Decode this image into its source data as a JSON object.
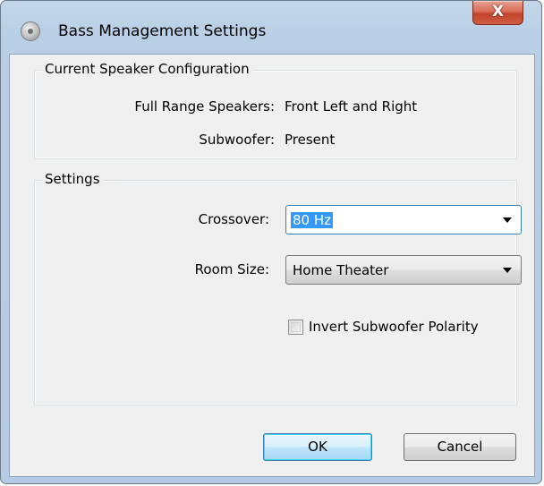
{
  "window": {
    "title": "Bass Management Settings",
    "close_label": "X",
    "app_icon": "speaker-disc-icon"
  },
  "current_config": {
    "legend": "Current Speaker Configuration",
    "full_range_label": "Full Range Speakers:",
    "full_range_value": "Front Left and Right",
    "subwoofer_label": "Subwoofer:",
    "subwoofer_value": "Present"
  },
  "settings": {
    "legend": "Settings",
    "crossover_label": "Crossover:",
    "crossover_value": "80 Hz",
    "room_size_label": "Room Size:",
    "room_size_value": "Home Theater",
    "invert_polarity_label": "Invert Subwoofer Polarity",
    "invert_polarity_checked": false
  },
  "buttons": {
    "ok_label": "OK",
    "cancel_label": "Cancel"
  },
  "colors": {
    "title_bar": "#b9cfe6",
    "client_bg": "#f0f0f0",
    "close_button": "#c2442c",
    "selection": "#3399ff",
    "default_button_border": "#3c7fb1"
  }
}
